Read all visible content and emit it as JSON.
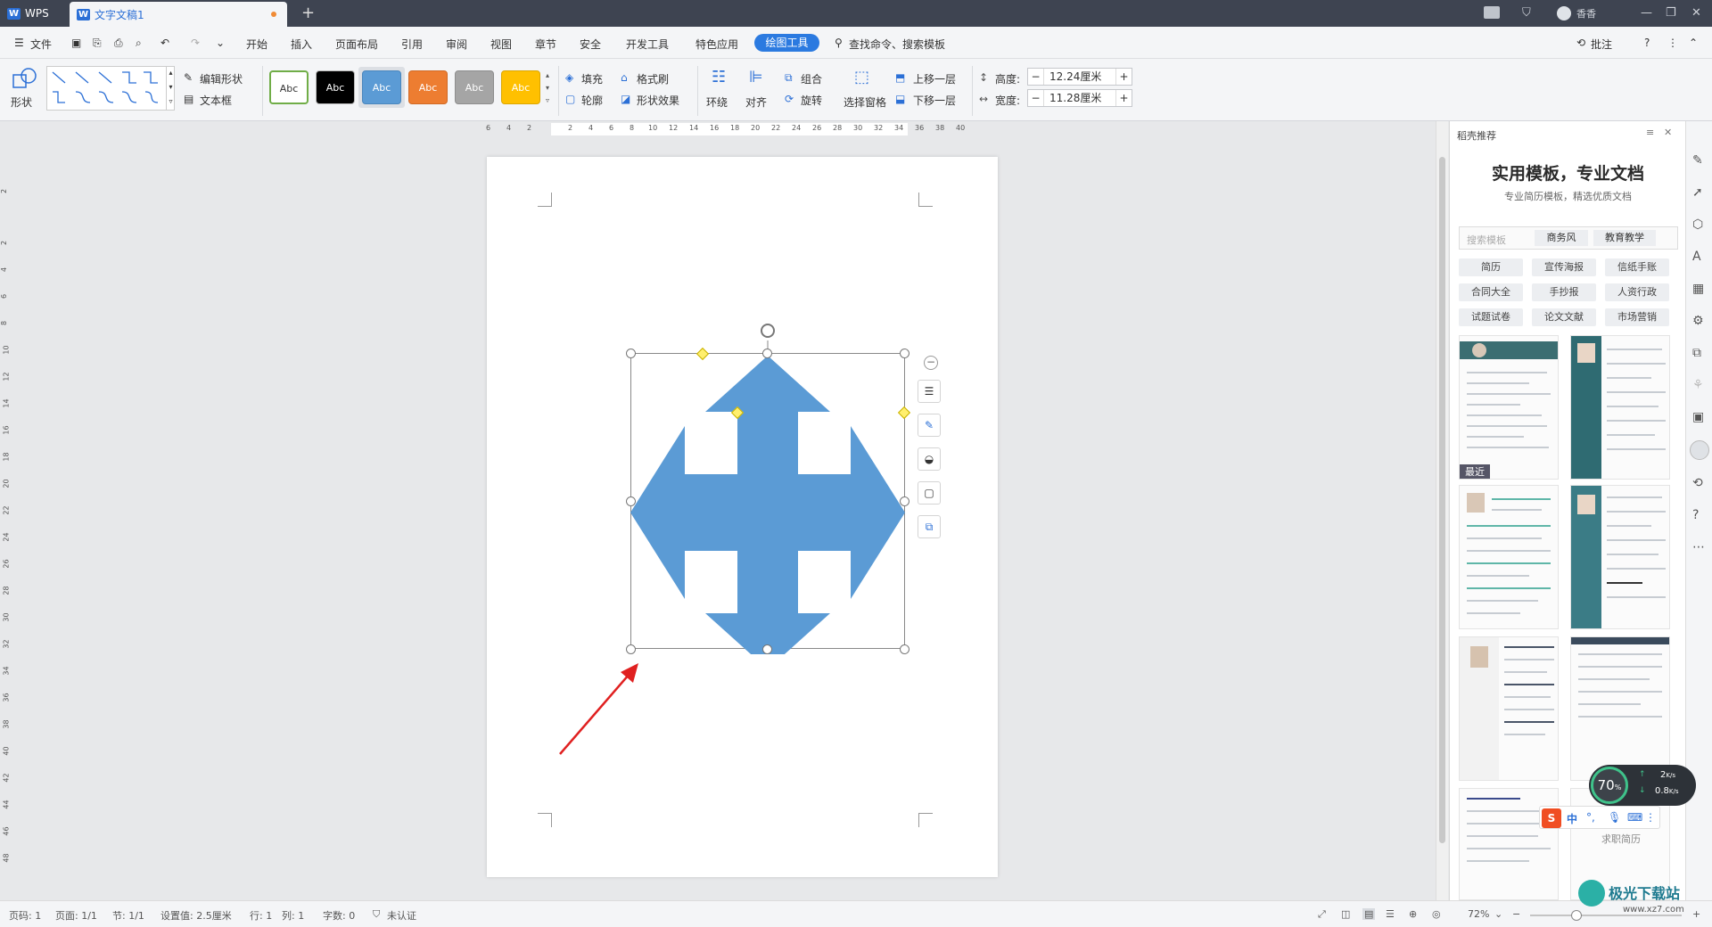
{
  "titlebar": {
    "app_tab": "WPS",
    "doc_tab": "文字文稿1",
    "new_tab": "+",
    "user": "香香"
  },
  "menu": {
    "file": "文件",
    "items": [
      "开始",
      "插入",
      "页面布局",
      "引用",
      "审阅",
      "视图",
      "章节",
      "安全",
      "开发工具",
      "特色应用"
    ],
    "active": "绘图工具",
    "search": "查找命令、搜索模板",
    "annotate": "批注"
  },
  "ribbon": {
    "shape": "形状",
    "edit_shape": "编辑形状",
    "text_box": "文本框",
    "style_labels": [
      "Abc",
      "Abc",
      "Abc",
      "Abc",
      "Abc",
      "Abc"
    ],
    "style_colors": [
      "#ffffff",
      "#000000",
      "#5b9bd5",
      "#ed7d31",
      "#a5a5a5",
      "#ffc000"
    ],
    "fill": "填充",
    "format_painter": "格式刷",
    "outline": "轮廓",
    "shape_effect": "形状效果",
    "wrap": "环绕",
    "align": "对齐",
    "group": "组合",
    "rotate": "旋转",
    "select_pane": "选择窗格",
    "bring_forward": "上移一层",
    "send_backward": "下移一层",
    "height_label": "高度:",
    "height_value": "12.24厘米",
    "width_label": "宽度:",
    "width_value": "11.28厘米",
    "minus": "−",
    "plus": "+"
  },
  "ruler": {
    "h_ticks": [
      "6",
      "4",
      "2",
      "2",
      "4",
      "6",
      "8",
      "10",
      "12",
      "14",
      "16",
      "18",
      "20",
      "22",
      "24",
      "26",
      "28",
      "30",
      "32",
      "34",
      "36",
      "38",
      "40"
    ],
    "v_ticks": [
      "2",
      "2",
      "4",
      "6",
      "8",
      "10",
      "12",
      "14",
      "16",
      "18",
      "20",
      "22",
      "24",
      "26",
      "28",
      "30",
      "32",
      "34",
      "36",
      "38",
      "40",
      "42",
      "44",
      "46",
      "48"
    ]
  },
  "document": {
    "shape_fill": "#5b9bd5",
    "annotation_arrow_color": "#e02020"
  },
  "panel": {
    "header": "稻壳推荐",
    "title": "实用模板，专业文档",
    "subtitle": "专业简历模板，精选优质文档",
    "search_placeholder": "搜索模板",
    "search_tags": [
      "商务风",
      "教育教学"
    ],
    "chips": [
      "简历",
      "宣传海报",
      "信纸手账",
      "合同大全",
      "手抄报",
      "人资行政",
      "试题试卷",
      "论文文献",
      "市场营销"
    ],
    "recent_badge": "最近",
    "cover_text": "求职简历"
  },
  "overlay": {
    "speed_percent": "70",
    "percent_sign": "%",
    "upload": "2",
    "download": "0.8",
    "unit": "K/s",
    "ime": "中",
    "watermark": "极光下载站",
    "watermark_url": "www.xz7.com"
  },
  "statusbar": {
    "page_code": "页码: 1",
    "page": "页面: 1/1",
    "section": "节: 1/1",
    "setting": "设置值: 2.5厘米",
    "row": "行: 1",
    "col": "列: 1",
    "words": "字数: 0",
    "auth": "未认证",
    "zoom": "72%"
  }
}
